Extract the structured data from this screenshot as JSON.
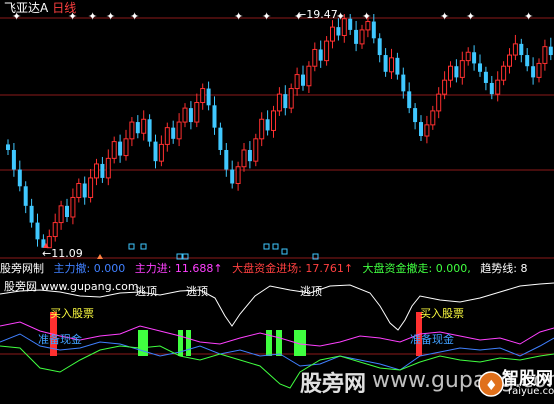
{
  "header": {
    "stock_title": "飞亚达A",
    "period_label": "日线"
  },
  "price_chart": {
    "high_label": "19.47",
    "low_label": "11.09"
  },
  "indicator_bar": {
    "name": "股旁网制",
    "item1_label": "主力撤: 0.000",
    "item2_label": "主力进: 11.688↑",
    "item3_label": "大盘资金进场: 17.761↑",
    "item4_label": "大盘资金撤走: 0.000,",
    "item5_label": "趋势线: 8",
    "colors": {
      "item1": "#4080ff",
      "item2": "#ff40ff",
      "item3": "#ff4040",
      "item4": "#40ff40",
      "item5": "#ffffff"
    }
  },
  "sub_chart": {
    "site_label": "股旁网 www.gupang.com",
    "sell_labels": [
      "逃顶",
      "逃顶",
      "逃顶"
    ],
    "buy_labels": [
      "买入股票",
      "买入股票"
    ],
    "cash_labels": [
      "准备现金",
      "准备现金"
    ]
  },
  "watermarks": {
    "text1": "股旁网",
    "text2": "www.gupang.com",
    "logo_text": "智股网",
    "logo_url": "raiyue.com"
  },
  "chart_data": {
    "type": "candlestick",
    "y_high": 19.47,
    "y_low": 11.09,
    "closes": [
      14.6,
      13.9,
      13.3,
      12.6,
      12.0,
      11.4,
      11.1,
      11.5,
      12.0,
      12.6,
      12.2,
      12.9,
      13.4,
      12.9,
      13.6,
      14.1,
      13.6,
      14.3,
      14.9,
      14.4,
      15.0,
      15.6,
      15.2,
      15.7,
      14.9,
      14.2,
      14.8,
      15.4,
      15.0,
      15.6,
      16.1,
      15.6,
      16.3,
      16.8,
      16.2,
      15.4,
      14.6,
      13.9,
      13.4,
      14.0,
      14.6,
      14.2,
      15.0,
      15.7,
      15.3,
      16.0,
      16.6,
      16.1,
      16.8,
      17.3,
      16.9,
      17.6,
      18.2,
      17.8,
      18.5,
      19.0,
      18.7,
      19.3,
      18.9,
      18.4,
      18.9,
      19.2,
      18.6,
      18.0,
      17.4,
      17.9,
      17.3,
      16.7,
      16.1,
      15.6,
      15.1,
      15.5,
      16.0,
      16.6,
      17.1,
      17.6,
      17.2,
      17.8,
      18.1,
      17.7,
      17.4,
      17.0,
      16.6,
      17.1,
      17.6,
      18.0,
      18.4,
      18.0,
      17.6,
      17.2,
      17.7,
      18.3,
      18.0
    ]
  }
}
